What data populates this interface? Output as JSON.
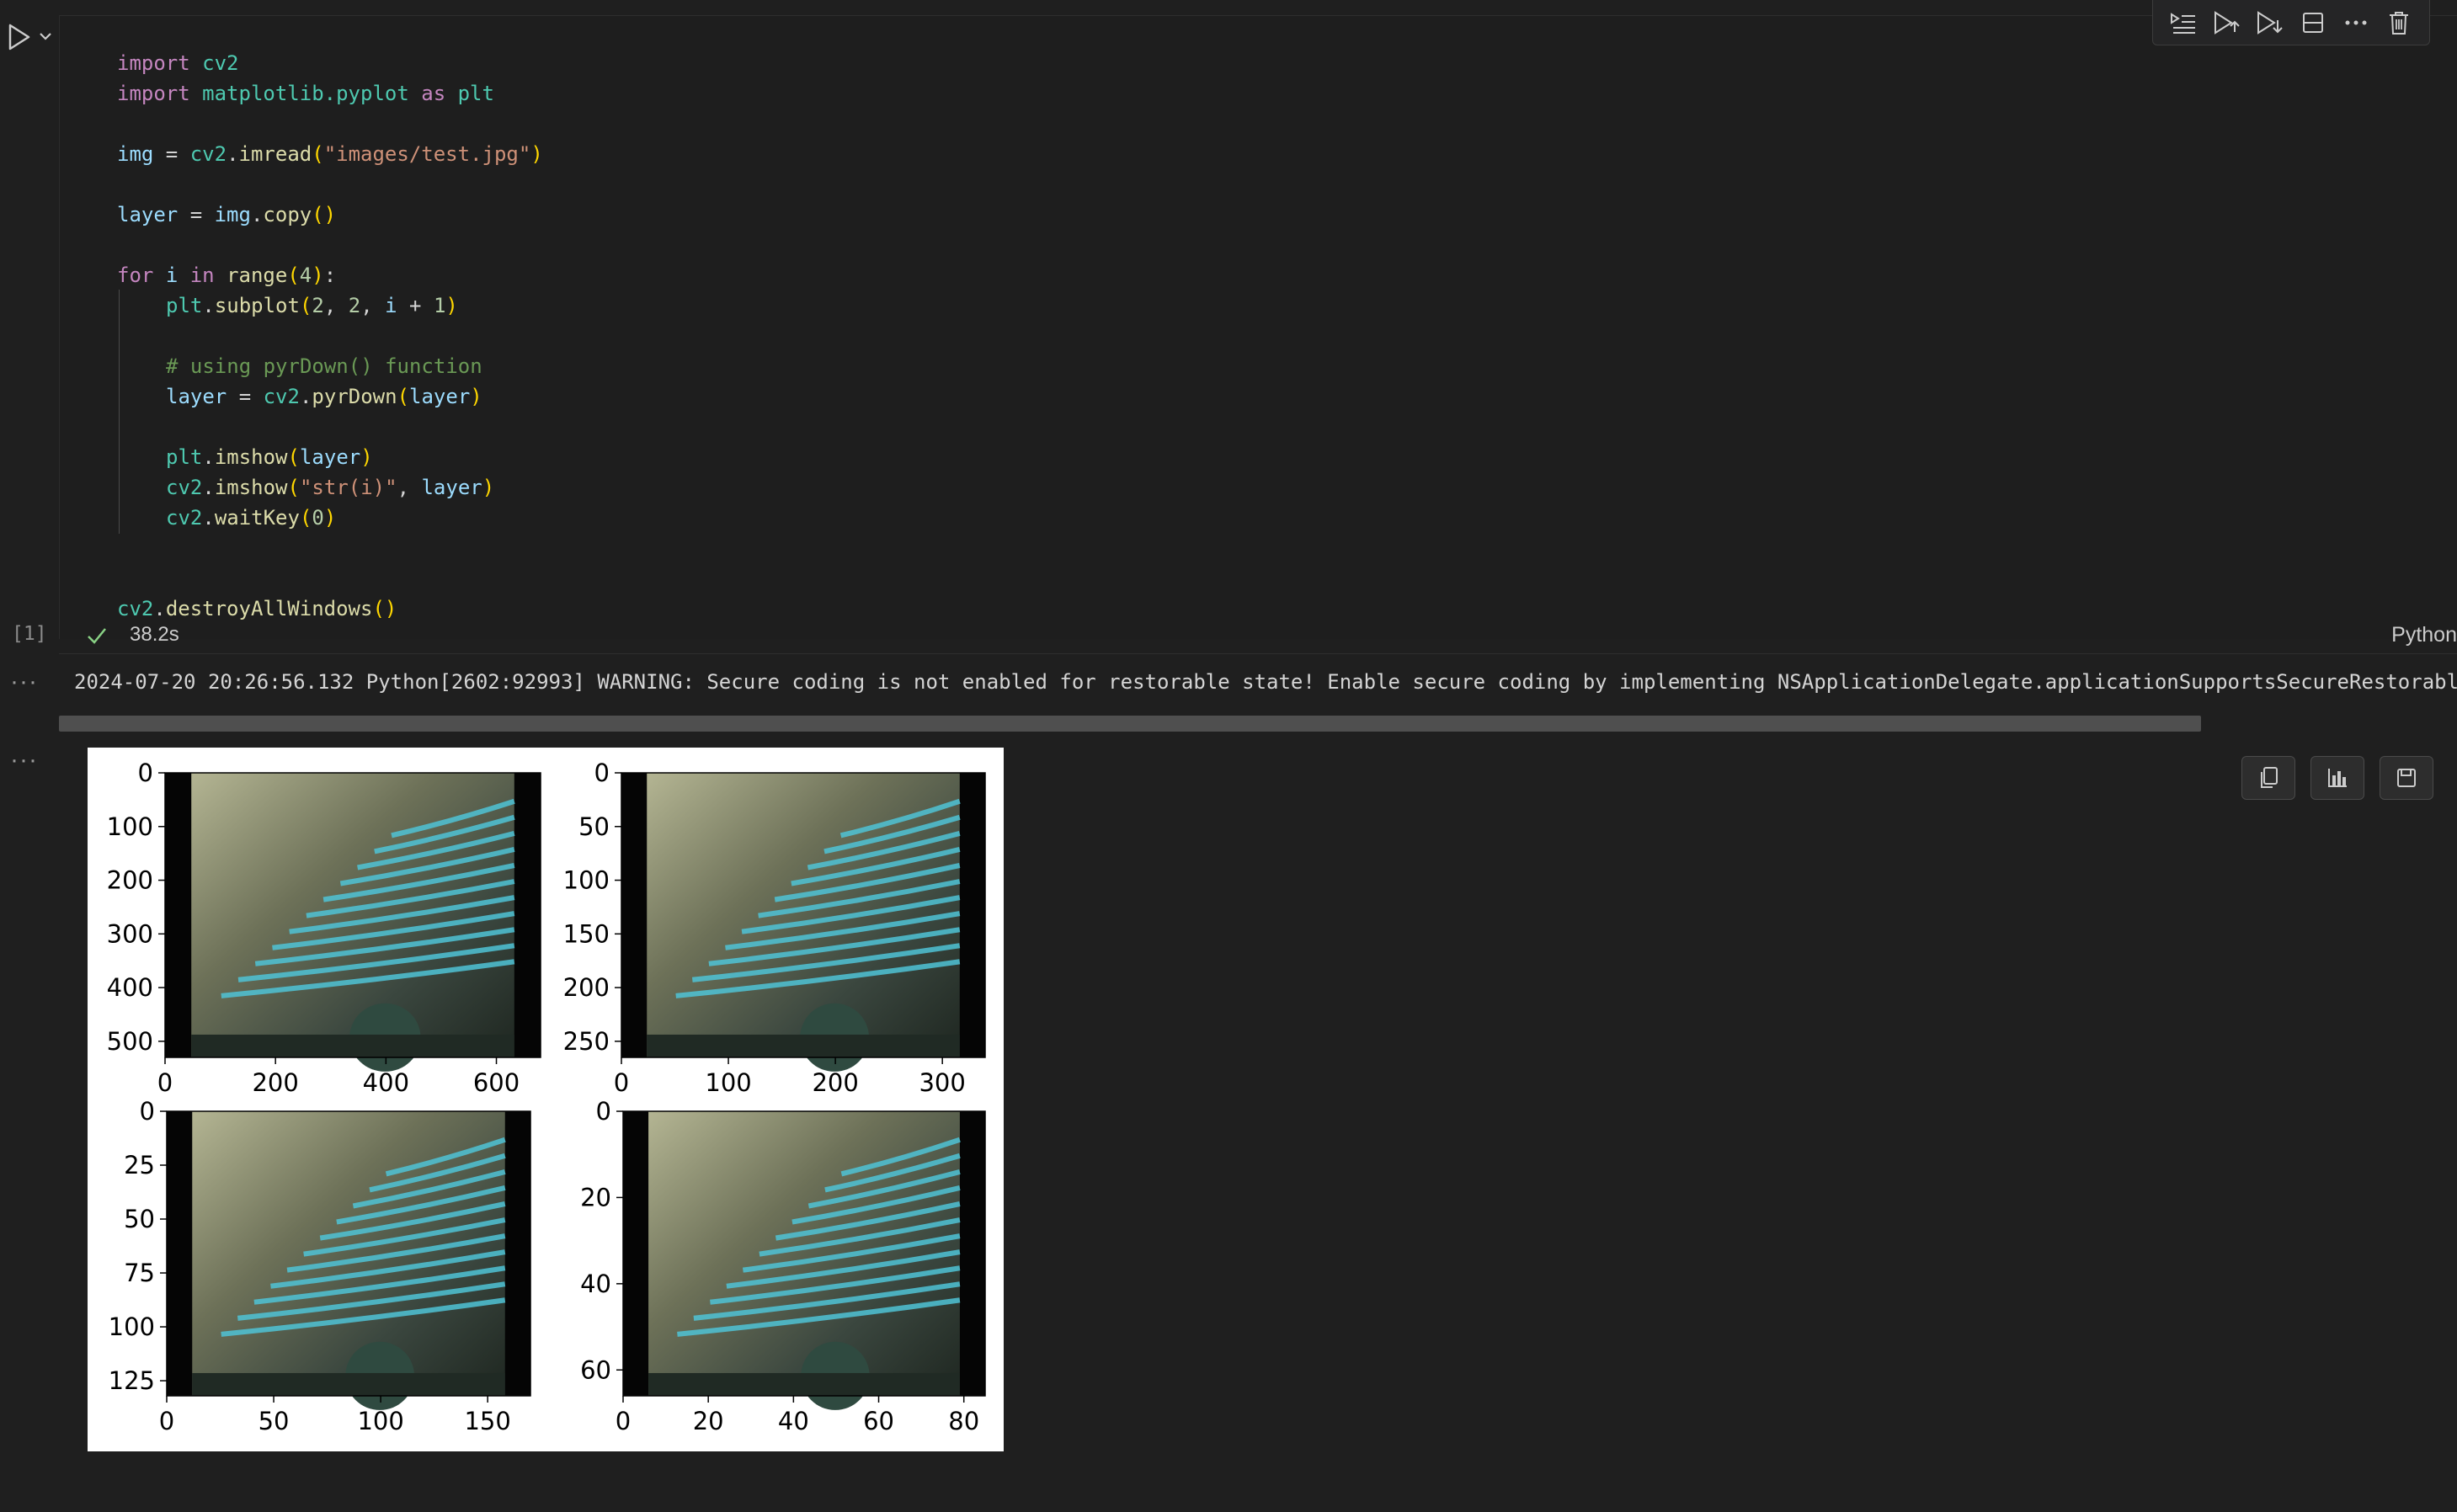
{
  "cell": {
    "execution_count": "[1]",
    "elapsed": "38.2s",
    "kernel": "Python",
    "code_lines": [
      [
        {
          "t": "import",
          "c": "kw"
        },
        {
          "t": " ",
          "c": "plain"
        },
        {
          "t": "cv2",
          "c": "md"
        }
      ],
      [
        {
          "t": "import",
          "c": "kw"
        },
        {
          "t": " ",
          "c": "plain"
        },
        {
          "t": "matplotlib.pyplot",
          "c": "md"
        },
        {
          "t": " ",
          "c": "plain"
        },
        {
          "t": "as",
          "c": "kw"
        },
        {
          "t": " ",
          "c": "plain"
        },
        {
          "t": "plt",
          "c": "md"
        }
      ],
      [],
      [
        {
          "t": "img",
          "c": "var"
        },
        {
          "t": " = ",
          "c": "plain"
        },
        {
          "t": "cv2",
          "c": "md"
        },
        {
          "t": ".",
          "c": "plain"
        },
        {
          "t": "imread",
          "c": "fn"
        },
        {
          "t": "(",
          "c": "p1"
        },
        {
          "t": "\"images/test.jpg\"",
          "c": "str"
        },
        {
          "t": ")",
          "c": "p1"
        }
      ],
      [],
      [
        {
          "t": "layer",
          "c": "var"
        },
        {
          "t": " = ",
          "c": "plain"
        },
        {
          "t": "img",
          "c": "var"
        },
        {
          "t": ".",
          "c": "plain"
        },
        {
          "t": "copy",
          "c": "fn"
        },
        {
          "t": "()",
          "c": "p1"
        }
      ],
      [],
      [
        {
          "t": "for",
          "c": "kw"
        },
        {
          "t": " ",
          "c": "plain"
        },
        {
          "t": "i",
          "c": "var"
        },
        {
          "t": " ",
          "c": "plain"
        },
        {
          "t": "in",
          "c": "kw"
        },
        {
          "t": " ",
          "c": "plain"
        },
        {
          "t": "range",
          "c": "fn"
        },
        {
          "t": "(",
          "c": "p1"
        },
        {
          "t": "4",
          "c": "num"
        },
        {
          "t": ")",
          "c": "p1"
        },
        {
          "t": ":",
          "c": "plain"
        }
      ],
      [
        {
          "t": "plt",
          "c": "md"
        },
        {
          "t": ".",
          "c": "plain"
        },
        {
          "t": "subplot",
          "c": "fn"
        },
        {
          "t": "(",
          "c": "p1"
        },
        {
          "t": "2",
          "c": "num"
        },
        {
          "t": ", ",
          "c": "plain"
        },
        {
          "t": "2",
          "c": "num"
        },
        {
          "t": ", ",
          "c": "plain"
        },
        {
          "t": "i",
          "c": "var"
        },
        {
          "t": " + ",
          "c": "plain"
        },
        {
          "t": "1",
          "c": "num"
        },
        {
          "t": ")",
          "c": "p1"
        }
      ],
      [],
      [
        {
          "t": "# using pyrDown() function",
          "c": "cmt"
        }
      ],
      [
        {
          "t": "layer",
          "c": "var"
        },
        {
          "t": " = ",
          "c": "plain"
        },
        {
          "t": "cv2",
          "c": "md"
        },
        {
          "t": ".",
          "c": "plain"
        },
        {
          "t": "pyrDown",
          "c": "fn"
        },
        {
          "t": "(",
          "c": "p1"
        },
        {
          "t": "layer",
          "c": "var"
        },
        {
          "t": ")",
          "c": "p1"
        }
      ],
      [],
      [
        {
          "t": "plt",
          "c": "md"
        },
        {
          "t": ".",
          "c": "plain"
        },
        {
          "t": "imshow",
          "c": "fn"
        },
        {
          "t": "(",
          "c": "p1"
        },
        {
          "t": "layer",
          "c": "var"
        },
        {
          "t": ")",
          "c": "p1"
        }
      ],
      [
        {
          "t": "cv2",
          "c": "md"
        },
        {
          "t": ".",
          "c": "plain"
        },
        {
          "t": "imshow",
          "c": "fn"
        },
        {
          "t": "(",
          "c": "p1"
        },
        {
          "t": "\"str(i)\"",
          "c": "str"
        },
        {
          "t": ", ",
          "c": "plain"
        },
        {
          "t": "layer",
          "c": "var"
        },
        {
          "t": ")",
          "c": "p1"
        }
      ],
      [
        {
          "t": "cv2",
          "c": "md"
        },
        {
          "t": ".",
          "c": "plain"
        },
        {
          "t": "waitKey",
          "c": "fn"
        },
        {
          "t": "(",
          "c": "p1"
        },
        {
          "t": "0",
          "c": "num"
        },
        {
          "t": ")",
          "c": "p1"
        }
      ],
      [],
      [],
      [
        {
          "t": "cv2",
          "c": "md"
        },
        {
          "t": ".",
          "c": "plain"
        },
        {
          "t": "destroyAllWindows",
          "c": "fn"
        },
        {
          "t": "()",
          "c": "p1"
        }
      ]
    ],
    "indented_lines": [
      8,
      9,
      10,
      11,
      12,
      13,
      14,
      15
    ]
  },
  "toolbar": {
    "icons": [
      "run-by-line-icon",
      "execute-above-icon",
      "execute-below-icon",
      "split-cell-icon",
      "more-actions-icon",
      "delete-cell-icon"
    ]
  },
  "outputs": {
    "stderr": "2024-07-20 20:26:56.132 Python[2602:92993] WARNING: Secure coding is not enabled for restorable state! Enable secure coding by implementing NSApplicationDelegate.applicationSupportsSecureRestorableState:",
    "more_label": "···",
    "actions": [
      "copy-icon",
      "chart-icon",
      "save-icon"
    ]
  },
  "colors": {
    "background": "#1f1f1f",
    "keyword": "#c586c0",
    "module": "#4ec9b0",
    "function": "#dcdcaa",
    "variable": "#9cdcfe",
    "string": "#ce9178",
    "number": "#b5cea8",
    "comment": "#6a9955",
    "success": "#89d185"
  },
  "chart_data": [
    {
      "type": "image",
      "description_of_image": "pyramid level 1",
      "yticks": [
        0,
        100,
        200,
        300,
        400,
        500
      ],
      "xticks": [
        0,
        200,
        400,
        600
      ],
      "xlim": [
        0,
        680
      ],
      "ylim": [
        530,
        0
      ]
    },
    {
      "type": "image",
      "description_of_image": "pyramid level 2",
      "yticks": [
        0,
        50,
        100,
        150,
        200,
        250
      ],
      "xticks": [
        0,
        100,
        200,
        300
      ],
      "xlim": [
        0,
        340
      ],
      "ylim": [
        265,
        0
      ]
    },
    {
      "type": "image",
      "description_of_image": "pyramid level 3",
      "yticks": [
        0,
        25,
        50,
        75,
        100,
        125
      ],
      "xticks": [
        0,
        50,
        100,
        150
      ],
      "xlim": [
        0,
        170
      ],
      "ylim": [
        132,
        0
      ]
    },
    {
      "type": "image",
      "description_of_image": "pyramid level 4",
      "yticks": [
        0,
        20,
        40,
        60
      ],
      "xticks": [
        0,
        20,
        40,
        60,
        80
      ],
      "xlim": [
        0,
        85
      ],
      "ylim": [
        66,
        0
      ]
    }
  ]
}
